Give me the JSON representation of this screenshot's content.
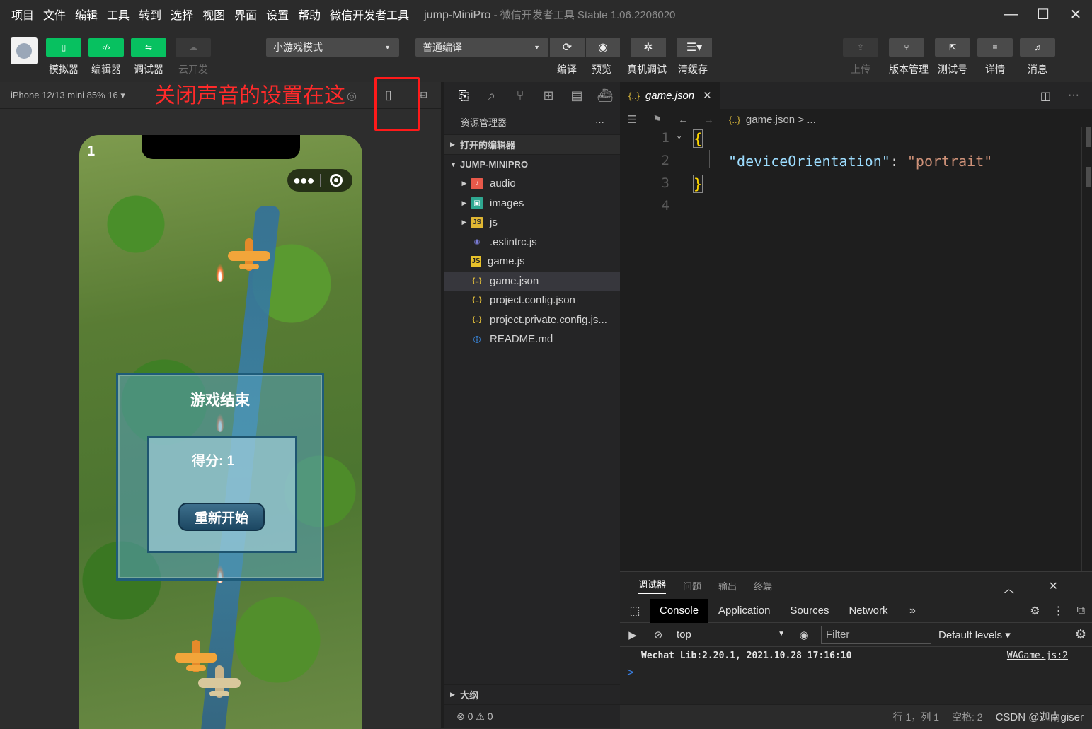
{
  "menubar": {
    "items": [
      "项目",
      "文件",
      "编辑",
      "工具",
      "转到",
      "选择",
      "视图",
      "界面",
      "设置",
      "帮助",
      "微信开发者工具"
    ],
    "project": "jump-MiniPro",
    "separator": " - ",
    "product": "微信开发者工具 Stable 1.06.2206020"
  },
  "toolbar": {
    "simulator": "模拟器",
    "editor": "编辑器",
    "debugger": "调试器",
    "cloud": "云开发",
    "mode_select": "小游戏模式",
    "compile_select": "普通编译",
    "compile": "编译",
    "preview": "预览",
    "remote_debug": "真机调试",
    "clear_cache": "清缓存",
    "upload": "上传",
    "version": "版本管理",
    "test": "测试号",
    "details": "详情",
    "messages": "消息"
  },
  "simulator": {
    "device": "iPhone 12/13 mini 85% 16 ▾",
    "annotation": "关闭声音的设置在这",
    "game": {
      "score_corner": "1",
      "over_title": "游戏结束",
      "score_text": "得分: 1",
      "restart": "重新开始"
    }
  },
  "explorer": {
    "header": "资源管理器",
    "more": "···",
    "open_editors": "打开的编辑器",
    "project": "JUMP-MINIPRO",
    "files": [
      {
        "name": "audio",
        "type": "folder",
        "icon": "folder-audio-icon"
      },
      {
        "name": "images",
        "type": "folder",
        "icon": "folder-images-icon"
      },
      {
        "name": "js",
        "type": "folder",
        "icon": "folder-js-icon"
      },
      {
        "name": ".eslintrc.js",
        "type": "file",
        "icon": "eslint-icon"
      },
      {
        "name": "game.js",
        "type": "file",
        "icon": "js-file-icon"
      },
      {
        "name": "game.json",
        "type": "file",
        "icon": "json-file-icon",
        "selected": true
      },
      {
        "name": "project.config.json",
        "type": "file",
        "icon": "json-file-icon"
      },
      {
        "name": "project.private.config.js...",
        "type": "file",
        "icon": "json-file-icon"
      },
      {
        "name": "README.md",
        "type": "file",
        "icon": "info-icon"
      }
    ],
    "outline": "大纲",
    "problems": "⊗ 0 ⚠ 0"
  },
  "editor": {
    "tab": "game.json",
    "breadcrumb_file": "game.json",
    "breadcrumb_more": "> ...",
    "json_glyph": "{..}",
    "line_numbers": [
      "1",
      "2",
      "3",
      "4"
    ],
    "lines": {
      "l1": "{",
      "key": "\"deviceOrientation\"",
      "colon": ": ",
      "value": "\"portrait\"",
      "l3": "}"
    }
  },
  "debugger": {
    "tabs": [
      "调试器",
      "问题",
      "输出",
      "终端"
    ],
    "devtabs": [
      "Console",
      "Application",
      "Sources",
      "Network"
    ],
    "context": "top",
    "filter_placeholder": "Filter",
    "levels": "Default levels ▾",
    "log_text": "Wechat Lib:2.20.1, 2021.10.28 17:16:10",
    "log_source": "WAGame.js:2",
    "prompt": ">"
  },
  "status": {
    "position": "行 1，列 1",
    "spaces": "空格: 2",
    "watermark": "CSDN @迦南giser"
  }
}
